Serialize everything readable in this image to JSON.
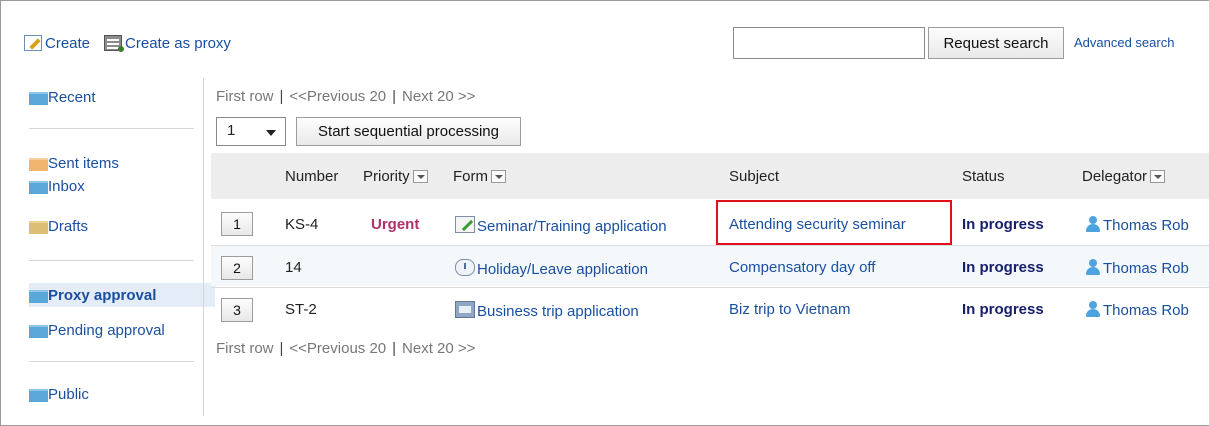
{
  "toolbar": {
    "create_label": "Create",
    "create_proxy_label": "Create as proxy",
    "search_value": "",
    "search_button_label": "Request search",
    "advanced_search_label": "Advanced search"
  },
  "sidebar": {
    "items": [
      {
        "label": "Recent",
        "icon": "folder-icon",
        "color": "#5aa8d8"
      },
      {
        "label": "Sent items",
        "icon": "folder-icon",
        "color": "#f2b570"
      },
      {
        "label": "Inbox",
        "icon": "folder-icon",
        "color": "#5aa8d8"
      },
      {
        "label": "Drafts",
        "icon": "folder-icon",
        "color": "#dcbf73"
      },
      {
        "label": "Proxy approval",
        "icon": "folder-icon",
        "color": "#5aa8d8",
        "selected": true
      },
      {
        "label": "Pending approval",
        "icon": "folder-icon",
        "color": "#5aa8d8"
      },
      {
        "label": "Public",
        "icon": "folder-icon",
        "color": "#5aa8d8"
      }
    ]
  },
  "pager": {
    "first": "First row",
    "separator": "|",
    "previous": "<<Previous 20",
    "next": "Next 20 >>"
  },
  "sequential": {
    "select_value": "1",
    "button_label": "Start sequential processing"
  },
  "table": {
    "headers": {
      "number": "Number",
      "priority": "Priority",
      "form": "Form",
      "subject": "Subject",
      "status": "Status",
      "delegator": "Delegator"
    },
    "rows": [
      {
        "index": "1",
        "number": "KS-4",
        "priority": "Urgent",
        "form": "Seminar/Training application",
        "form_icon": "seminar-form-icon",
        "subject": "Attending security seminar",
        "status": "In progress",
        "delegator": "Thomas Rob"
      },
      {
        "index": "2",
        "number": "14",
        "priority": "",
        "form": "Holiday/Leave application",
        "form_icon": "holiday-form-icon",
        "subject": "Compensatory day off",
        "status": "In progress",
        "delegator": "Thomas Rob"
      },
      {
        "index": "3",
        "number": "ST-2",
        "priority": "",
        "form": "Business trip application",
        "form_icon": "business-trip-form-icon",
        "subject": "Biz trip to Vietnam",
        "status": "In progress",
        "delegator": "Thomas Rob"
      }
    ]
  },
  "colors": {
    "link": "#1a4fa0",
    "urgent": "#b0306a",
    "status": "#17206b",
    "highlight": "#e0101a"
  }
}
